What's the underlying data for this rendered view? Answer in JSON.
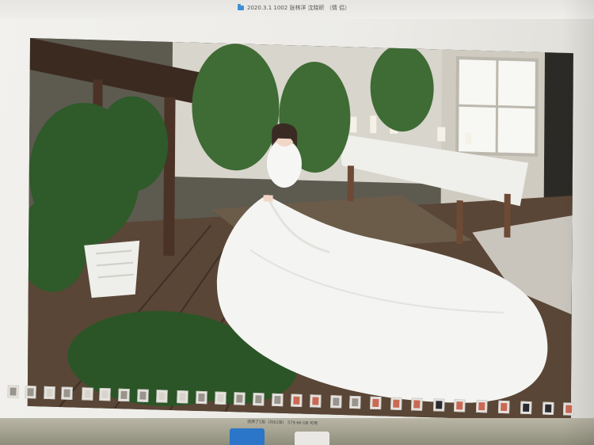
{
  "window": {
    "title": "2020.3.1 1002 张林洋 沈晓昕 （情 侣）",
    "folder_icon": "folder-icon"
  },
  "photo": {
    "subject": "bride-in-white-gown-photo"
  },
  "filmstrip": {
    "status_text": "选择了1张（共61张）  579.66 GB 可用"
  },
  "colors": {
    "floor": "#5a4636",
    "gown": "#f4f4f2",
    "plants": "#2f5a2a"
  }
}
